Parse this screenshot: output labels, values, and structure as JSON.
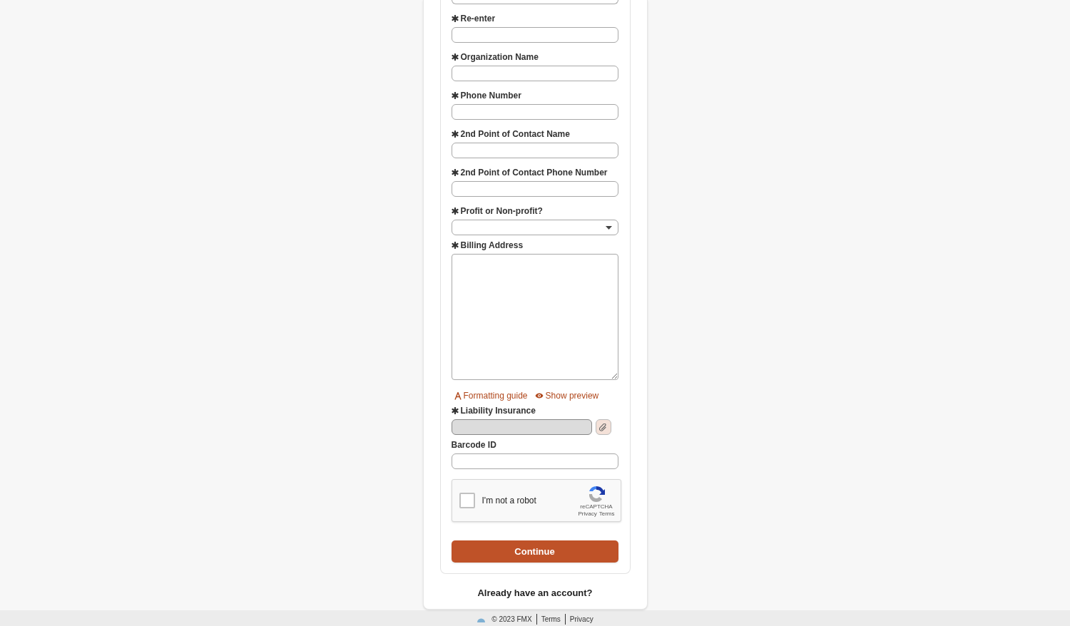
{
  "fields": [
    {
      "kind": "text",
      "label": "Re-enter",
      "required": true
    },
    {
      "kind": "text",
      "label": "Organization Name",
      "required": true
    },
    {
      "kind": "text",
      "label": "Phone Number",
      "required": true
    },
    {
      "kind": "text",
      "label": "2nd Point of Contact Name",
      "required": true
    },
    {
      "kind": "text",
      "label": "2nd Point of Contact Phone Number",
      "required": true
    },
    {
      "kind": "select",
      "label": "Profit or Non-profit?",
      "required": true
    },
    {
      "kind": "textarea",
      "label": "Billing Address",
      "required": true,
      "links": [
        "Formatting guide",
        "Show preview"
      ]
    },
    {
      "kind": "file",
      "label": "Liability Insurance",
      "required": true
    },
    {
      "kind": "text",
      "label": "Barcode ID",
      "required": false
    }
  ],
  "captcha": {
    "label": "I'm not a robot",
    "checked": false,
    "brand": "reCAPTCHA",
    "links": [
      "Privacy",
      "Terms"
    ]
  },
  "submit": "Continue",
  "signin_link": "Already have an account?",
  "footer": {
    "copyright": "© 2023 FMX",
    "links": [
      "Terms",
      "Privacy"
    ]
  }
}
